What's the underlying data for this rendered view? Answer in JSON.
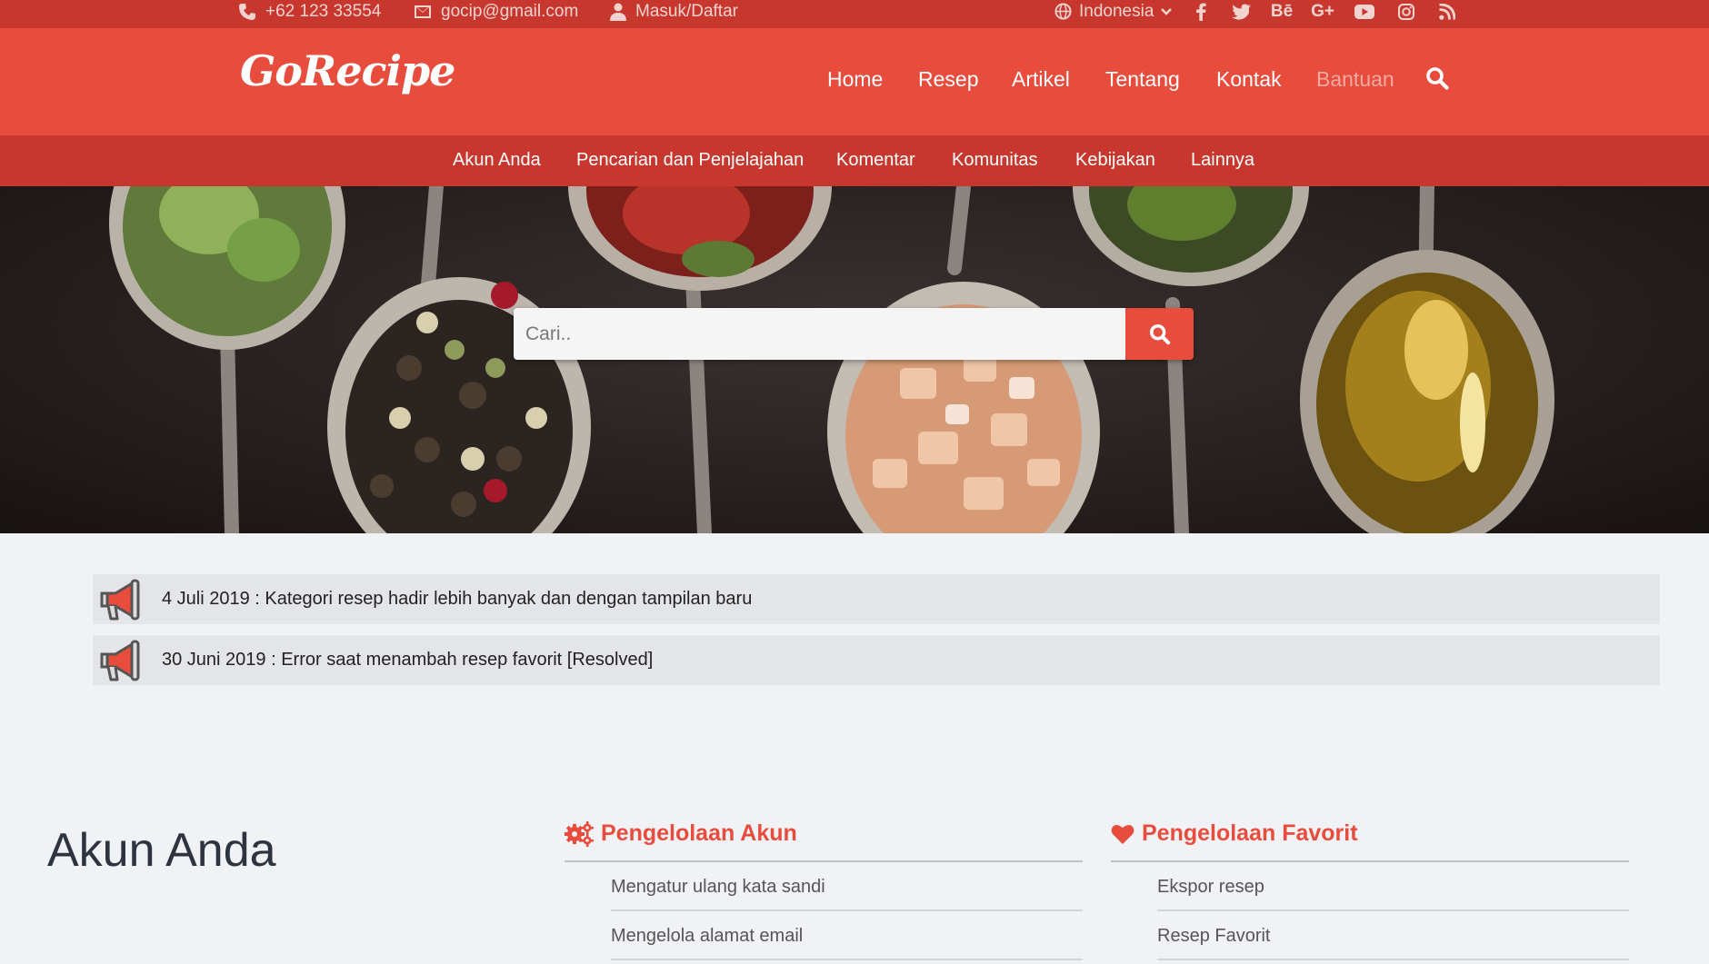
{
  "topbar": {
    "phone": "+62 123 33554",
    "email": "gocip@gmail.com",
    "account": "Masuk/Daftar",
    "language": "Indonesia",
    "social": [
      "facebook-icon",
      "twitter-icon",
      "behance-icon",
      "google-plus-icon",
      "youtube-icon",
      "instagram-icon",
      "rss-icon"
    ],
    "behance_label": "Bē",
    "gplus_label": "G+"
  },
  "header": {
    "logo": "GoRecipe",
    "nav": [
      "Home",
      "Resep",
      "Artikel",
      "Tentang",
      "Kontak",
      "Bantuan"
    ],
    "active_nav": "Bantuan"
  },
  "subnav": [
    "Akun Anda",
    "Pencarian dan Penjelajahan",
    "Komentar",
    "Komunitas",
    "Kebijakan",
    "Lainnya"
  ],
  "search": {
    "placeholder": "Cari.."
  },
  "announcements": [
    "4 Juli 2019 : Kategori resep hadir lebih banyak dan dengan tampilan baru",
    "30 Juni 2019 : Error saat menambah resep favorit [Resolved]"
  ],
  "help": {
    "section_title": "Akun Anda",
    "columns": [
      {
        "title": "Pengelolaan Akun",
        "icon": "gears-icon",
        "links": [
          "Mengatur ulang kata sandi",
          "Mengelola alamat email"
        ]
      },
      {
        "title": "Pengelolaan Favorit",
        "icon": "heart-icon",
        "links": [
          "Ekspor resep",
          "Resep Favorit"
        ]
      }
    ]
  },
  "colors": {
    "brand": "#e84c3d",
    "brand_dark": "#c8372d",
    "page_bg": "#f1f2f5"
  }
}
